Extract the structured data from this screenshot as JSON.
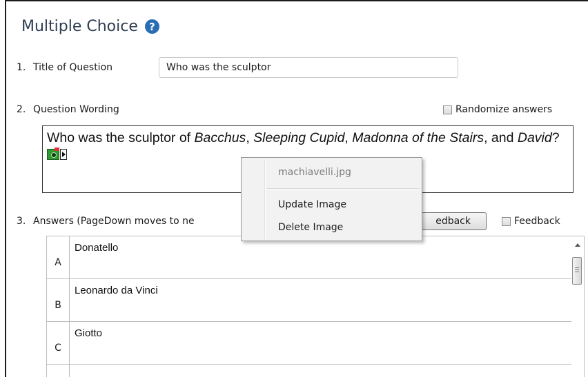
{
  "header": {
    "title": "Multiple Choice",
    "help_glyph": "?"
  },
  "question_title": {
    "number": "1.",
    "label": "Title of Question",
    "value": "Who was the sculptor"
  },
  "question_wording": {
    "number": "2.",
    "label": "Question Wording",
    "randomize_label": "Randomize answers",
    "text_parts": [
      "Who was the sculptor of ",
      "Bacchus",
      ", ",
      "Sleeping Cupid",
      ", ",
      "Madonna of the Stairs",
      ", and ",
      "David",
      "?"
    ]
  },
  "context_menu": {
    "filename": "machiavelli.jpg",
    "items": [
      "Update Image",
      "Delete Image"
    ]
  },
  "answers": {
    "number": "3.",
    "label": "Answers  (PageDown moves to ne",
    "feedback_button_label": "edback",
    "feedback_checkbox_label": "Feedback",
    "rows": [
      {
        "letter": "A",
        "text": "Donatello"
      },
      {
        "letter": "B",
        "text": "Leonardo da Vinci"
      },
      {
        "letter": "C",
        "text": "Giotto"
      }
    ]
  },
  "colors": {
    "title": "#2e3d52",
    "help_icon": "#2a6db4",
    "camera_icon": "#2f9a30"
  },
  "icons": {
    "help": "question-circle-icon",
    "image": "camera-image-icon",
    "image_menu": "triangle-right-icon"
  }
}
